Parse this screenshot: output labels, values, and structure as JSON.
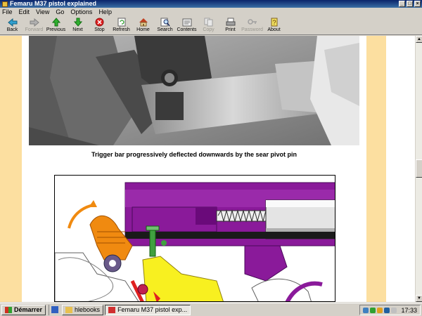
{
  "window": {
    "title": "Femaru M37 pistol explained"
  },
  "menu": [
    "File",
    "Edit",
    "View",
    "Go",
    "Options",
    "Help"
  ],
  "toolbar": [
    {
      "label": "Back",
      "icon": "back-arrow-icon",
      "enabled": true
    },
    {
      "label": "Forward",
      "icon": "forward-arrow-icon",
      "enabled": false
    },
    {
      "label": "Previous",
      "icon": "up-arrow-icon",
      "enabled": true
    },
    {
      "label": "Next",
      "icon": "down-arrow-icon",
      "enabled": true
    },
    {
      "label": "Stop",
      "icon": "stop-icon",
      "enabled": true
    },
    {
      "label": "Refresh",
      "icon": "refresh-icon",
      "enabled": true
    },
    {
      "label": "Home",
      "icon": "home-icon",
      "enabled": true
    },
    {
      "label": "Search",
      "icon": "search-icon",
      "enabled": true
    },
    {
      "label": "Contents",
      "icon": "contents-icon",
      "enabled": true
    },
    {
      "label": "Copy",
      "icon": "copy-icon",
      "enabled": false
    },
    {
      "label": "Print",
      "icon": "print-icon",
      "enabled": true
    },
    {
      "label": "Password",
      "icon": "password-icon",
      "enabled": false
    },
    {
      "label": "About",
      "icon": "about-icon",
      "enabled": true
    }
  ],
  "content": {
    "caption": "Trigger bar progressively deflected downwards by the sear pivot pin"
  },
  "taskbar": {
    "start_label": "Démarrer",
    "tasks": [
      {
        "label": "hlebooks",
        "active": false
      },
      {
        "label": "Femaru M37 pistol exp...",
        "active": true
      }
    ],
    "clock": "17:33"
  },
  "colors": {
    "side_panel": "#fcdfa0",
    "slide_purple": "#8a1a9a",
    "hammer_orange": "#f08a10",
    "trigger_yellow": "#f8f020",
    "pin_green": "#40a040"
  }
}
